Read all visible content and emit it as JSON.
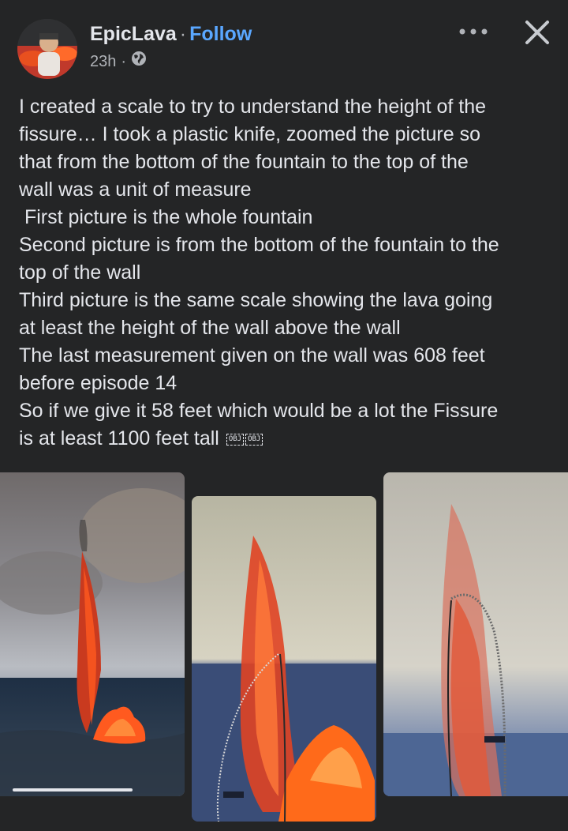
{
  "post": {
    "author": "EpicLava",
    "separator": "·",
    "follow_label": "Follow",
    "time": "23h",
    "time_separator": "·",
    "privacy_icon": "globe-icon",
    "more_icon": "more-horizontal-icon",
    "close_icon": "close-icon",
    "text_lines": [
      "I created a scale to try to understand the height of the",
      "fissure… I took a plastic knife, zoomed the picture so",
      "that from the bottom of the fountain to the top of the",
      "wall was a unit of measure",
      " First picture is the whole fountain",
      "Second picture is from the bottom of the fountain to the",
      "top of the wall",
      "Third picture is the same scale showing the lava going",
      "at least the height of the wall above the wall",
      "The last measurement given on the wall was 608 feet",
      "before episode 14",
      "So if we give it 58 feet which would be a lot the Fissure",
      "is at least 1100 feet tall"
    ],
    "obj_marks": [
      "OBJ",
      "OBJ"
    ]
  },
  "photos": {
    "first_progress": 0.65
  },
  "colors": {
    "background": "#242526",
    "text": "#e4e6eb",
    "secondary_text": "#b0b3b8",
    "link": "#5aa7ff",
    "lava": "#ff5a1f"
  }
}
